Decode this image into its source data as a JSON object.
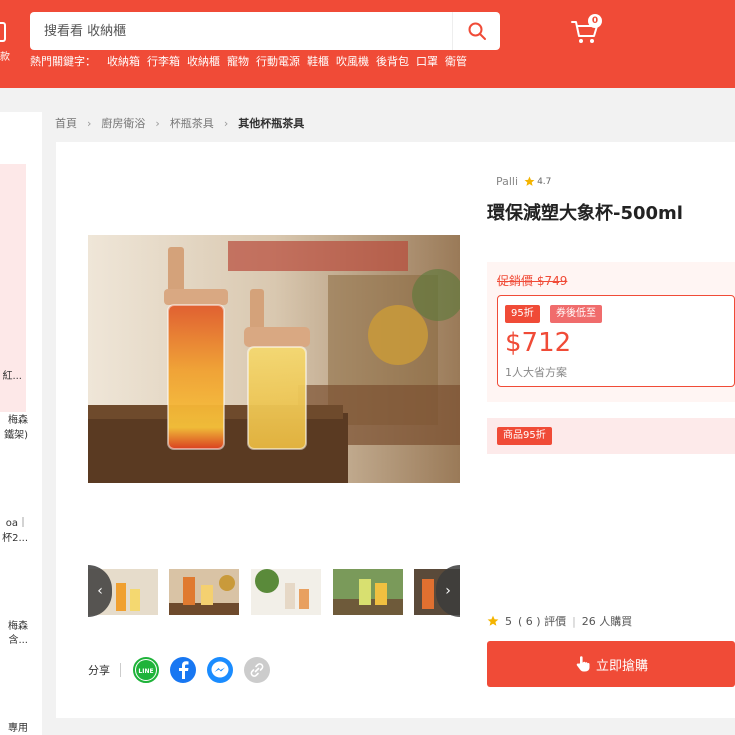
{
  "header": {
    "logo_text": "款",
    "search": {
      "placeholder": "搜看看 收納櫃"
    },
    "cart": {
      "count": "0"
    },
    "hot_keywords": {
      "label": "熱門關鍵字：",
      "items": [
        "收納箱",
        "行李箱",
        "收納櫃",
        "寵物",
        "行動電源",
        "鞋櫃",
        "吹風機",
        "後背包",
        "口罩",
        "衛管"
      ]
    }
  },
  "sidebar": {
    "snippets": [
      "紅...",
      "梅森",
      "鐵架)",
      "oa｜",
      "杯2...",
      "梅森",
      "含...",
      "專用"
    ]
  },
  "breadcrumb": {
    "items": [
      "首頁",
      "廚房衛浴",
      "杯瓶茶具"
    ],
    "current": "其他杯瓶茶具"
  },
  "product": {
    "brand": "Palli",
    "brand_rating": "4.7",
    "title": "環保減塑大象杯-500ml",
    "original_price": "促銷價 $749",
    "tags": {
      "discount": "95折",
      "deal": "券後低至"
    },
    "price": "$712",
    "plan_note": "1人大省方案",
    "promo_tag": "商品95折",
    "reviews": {
      "score": "5",
      "count": "( 6 ) 評價",
      "sold": "26 人購買"
    },
    "buy_label": "立即搶購"
  },
  "share": {
    "label": "分享",
    "line_label": "LINE"
  },
  "colors": {
    "brand_red": "#f04b37",
    "pink_bg": "#fff5f3",
    "promo_bg": "#fdeaea"
  },
  "icons": {
    "search": "search-icon",
    "cart": "cart-icon",
    "star": "star-icon",
    "line": "line-icon",
    "facebook": "facebook-icon",
    "messenger": "messenger-icon",
    "link": "link-icon",
    "hand": "hand-pointer-icon"
  }
}
